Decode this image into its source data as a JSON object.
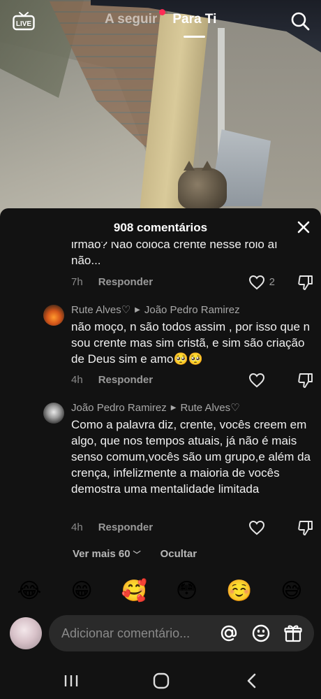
{
  "header": {
    "tabs": [
      {
        "label": "A seguir",
        "active": false
      },
      {
        "label": "Para Ti",
        "active": true
      }
    ],
    "live_icon": "live-tv-icon",
    "search_icon": "search-icon",
    "accent_color": "#fe2c55"
  },
  "comments_sheet": {
    "title": "908 comentários",
    "partial_comment": {
      "text_line1": "irmão? Não coloca crente nesse rolo aí",
      "text_line2": "não...",
      "time": "7h",
      "reply_label": "Responder",
      "likes": "2"
    },
    "comments": [
      {
        "author": "Rute Alves♡",
        "reply_to": "João Pedro Ramirez",
        "text": "não moço, n são todos assim , por isso que n sou crente mas sim cristã, e sim são criação de Deus sim e amo🥺🥺",
        "time": "4h",
        "reply_label": "Responder"
      },
      {
        "author": "João Pedro Ramirez",
        "reply_to": "Rute Alves♡",
        "text": "Como a palavra diz, crente, vocês creem em algo, que nos tempos atuais, já não é mais senso comum,vocês são um grupo,e além da crença, infelizmente a maioria de vocês demostra uma mentalidade limitada",
        "time": "4h",
        "reply_label": "Responder"
      }
    ],
    "view_more": "Ver mais 60",
    "hide": "Ocultar",
    "emojis": [
      "😂",
      "😁",
      "🥰",
      "😳",
      "☺️",
      "😅"
    ],
    "input_placeholder": "Adicionar comentário..."
  }
}
